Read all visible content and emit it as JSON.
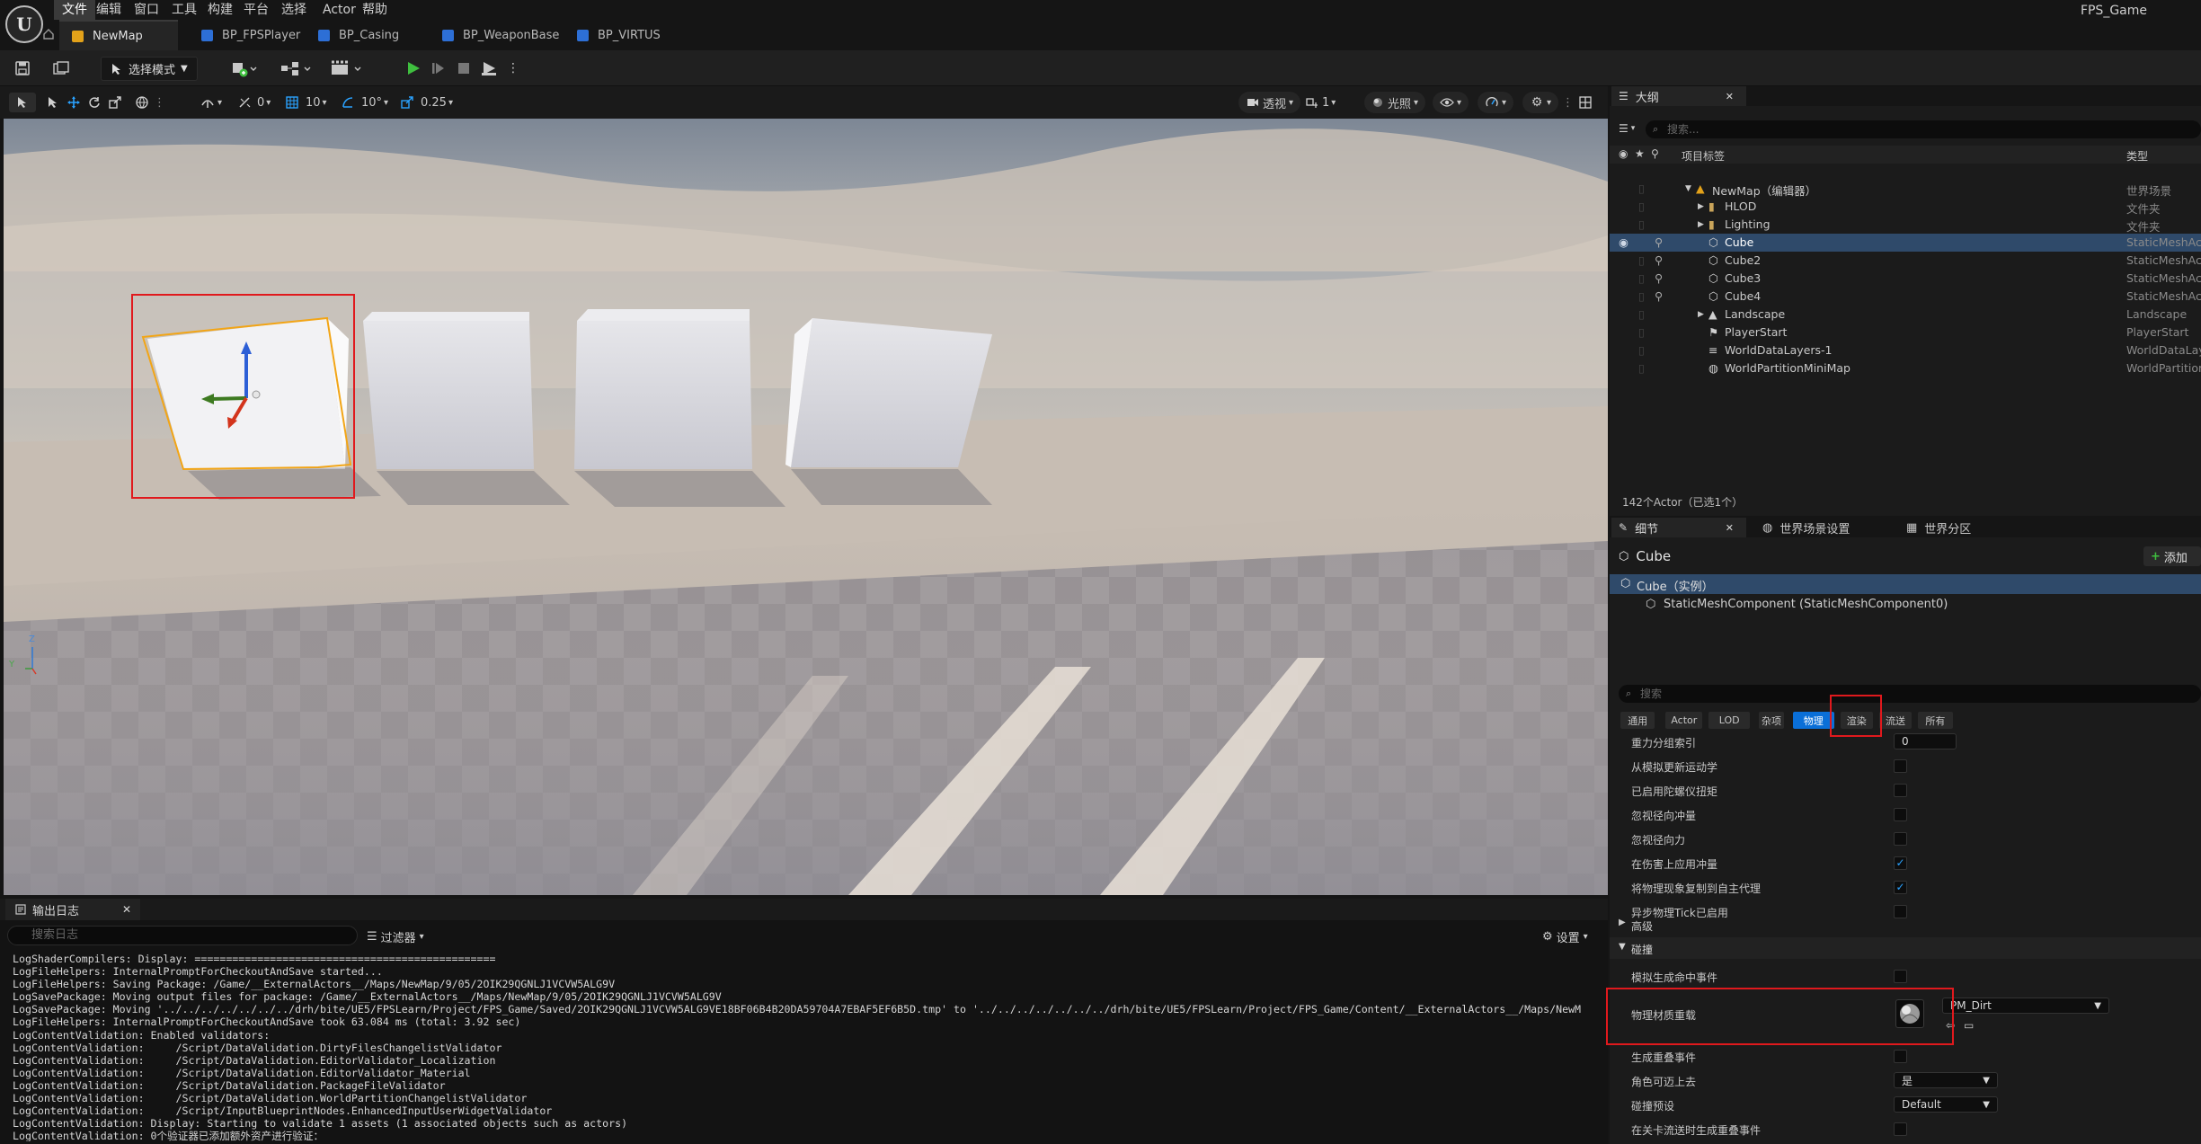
{
  "menu": {
    "items": [
      "文件",
      "编辑",
      "窗口",
      "工具",
      "构建",
      "平台",
      "选择",
      "Actor",
      "帮助"
    ],
    "active_index": 0,
    "project_name": "FPS_Game"
  },
  "tabs": [
    {
      "label": "NewMap",
      "icon": "map-icon",
      "active": true
    },
    {
      "label": "BP_FPSPlayer",
      "icon": "blueprint-icon",
      "active": false
    },
    {
      "label": "BP_Casing",
      "icon": "blueprint-icon",
      "active": false
    },
    {
      "label": "BP_WeaponBase",
      "icon": "blueprint-icon",
      "active": false
    },
    {
      "label": "BP_VIRTUS",
      "icon": "blueprint-icon",
      "active": false
    }
  ],
  "toolbar": {
    "mode_label": "选择模式"
  },
  "viewport_toolbar": {
    "angle_snap_1": "0",
    "grid_snap": "10",
    "rotation_snap": "10°",
    "scale_snap": "0.25",
    "perspective_label": "透视",
    "camera_speed": "1",
    "lighting_label": "光照"
  },
  "viewport": {
    "axis_z": "Z",
    "axis_y": "Y"
  },
  "output_log": {
    "tab_label": "输出日志",
    "search_placeholder": "搜索日志",
    "filter_label": "过滤器",
    "settings_label": "设置",
    "lines": [
      "LogShaderCompilers: Display: ================================================",
      "LogFileHelpers: InternalPromptForCheckoutAndSave started...",
      "LogFileHelpers: Saving Package: /Game/__ExternalActors__/Maps/NewMap/9/05/2OIK29QGNLJ1VCVW5ALG9V",
      "LogSavePackage: Moving output files for package: /Game/__ExternalActors__/Maps/NewMap/9/05/2OIK29QGNLJ1VCVW5ALG9V",
      "LogSavePackage: Moving '../../../../../../../drh/bite/UE5/FPSLearn/Project/FPS_Game/Saved/2OIK29QGNLJ1VCVW5ALG9VE18BF06B4B20DA59704A7EBAF5EF6B5D.tmp' to '../../../../../../../drh/bite/UE5/FPSLearn/Project/FPS_Game/Content/__ExternalActors__/Maps/NewM",
      "LogFileHelpers: InternalPromptForCheckoutAndSave took 63.084 ms (total: 3.92 sec)",
      "LogContentValidation: Enabled validators:",
      "LogContentValidation:     /Script/DataValidation.DirtyFilesChangelistValidator",
      "LogContentValidation:     /Script/DataValidation.EditorValidator_Localization",
      "LogContentValidation:     /Script/DataValidation.EditorValidator_Material",
      "LogContentValidation:     /Script/DataValidation.PackageFileValidator",
      "LogContentValidation:     /Script/DataValidation.WorldPartitionChangelistValidator",
      "LogContentValidation:     /Script/InputBlueprintNodes.EnhancedInputUserWidgetValidator",
      "LogContentValidation: Display: Starting to validate 1 assets (1 associated objects such as actors)",
      "LogContentValidation: 0个验证器已添加额外资产进行验证："
    ]
  },
  "outliner": {
    "tab_label": "大纲",
    "search_placeholder": "搜索...",
    "col_label": "项目标签",
    "col_type": "类型",
    "rows": [
      {
        "label": "NewMap（编辑器）",
        "type": "世界场景",
        "indent": 0,
        "icon": "map-icon",
        "expand": "down",
        "selected": false,
        "eye": false,
        "pin": false
      },
      {
        "label": "HLOD",
        "type": "文件夹",
        "indent": 1,
        "icon": "folder-icon",
        "expand": "right",
        "selected": false,
        "eye": false,
        "pin": false
      },
      {
        "label": "Lighting",
        "type": "文件夹",
        "indent": 1,
        "icon": "folder-icon",
        "expand": "right",
        "selected": false,
        "eye": false,
        "pin": false
      },
      {
        "label": "Cube",
        "type": "StaticMeshActor",
        "indent": 1,
        "icon": "mesh-icon",
        "expand": "",
        "selected": true,
        "eye": true,
        "pin": true
      },
      {
        "label": "Cube2",
        "type": "StaticMeshActor",
        "indent": 1,
        "icon": "mesh-icon",
        "expand": "",
        "selected": false,
        "eye": false,
        "pin": true
      },
      {
        "label": "Cube3",
        "type": "StaticMeshActor",
        "indent": 1,
        "icon": "mesh-icon",
        "expand": "",
        "selected": false,
        "eye": false,
        "pin": true
      },
      {
        "label": "Cube4",
        "type": "StaticMeshActor",
        "indent": 1,
        "icon": "mesh-icon",
        "expand": "",
        "selected": false,
        "eye": false,
        "pin": true
      },
      {
        "label": "Landscape",
        "type": "Landscape",
        "indent": 1,
        "icon": "landscape-icon",
        "expand": "right",
        "selected": false,
        "eye": false,
        "pin": false
      },
      {
        "label": "PlayerStart",
        "type": "PlayerStart",
        "indent": 1,
        "icon": "player-start-icon",
        "expand": "",
        "selected": false,
        "eye": false,
        "pin": false
      },
      {
        "label": "WorldDataLayers-1",
        "type": "WorldDataLayers",
        "indent": 1,
        "icon": "data-layers-icon",
        "expand": "",
        "selected": false,
        "eye": false,
        "pin": false
      },
      {
        "label": "WorldPartitionMiniMap",
        "type": "WorldPartitionMiniMap",
        "indent": 1,
        "icon": "minimap-icon",
        "expand": "",
        "selected": false,
        "eye": false,
        "pin": false
      }
    ],
    "actor_count": "142个Actor（已选1个）"
  },
  "details": {
    "tabs": [
      "细节",
      "世界场景设置",
      "世界分区"
    ],
    "actor_name": "Cube",
    "add_label": "添加",
    "instance_label": "Cube（实例）",
    "component_label": "StaticMeshComponent (StaticMeshComponent0)",
    "search_placeholder": "搜索",
    "category_tabs": [
      "通用",
      "Actor",
      "LOD",
      "杂项",
      "物理",
      "渲染",
      "流送",
      "所有"
    ],
    "active_category": 4,
    "physics_props": [
      {
        "label": "重力分组索引",
        "kind": "number",
        "value": "0"
      },
      {
        "label": "从模拟更新运动学",
        "kind": "check",
        "checked": false
      },
      {
        "label": "已启用陀螺仪扭矩",
        "kind": "check",
        "checked": false
      },
      {
        "label": "忽视径向冲量",
        "kind": "check",
        "checked": false
      },
      {
        "label": "忽视径向力",
        "kind": "check",
        "checked": false
      },
      {
        "label": "在伤害上应用冲量",
        "kind": "check",
        "checked": true
      },
      {
        "label": "将物理现象复制到自主代理",
        "kind": "check",
        "checked": true
      },
      {
        "label": "异步物理Tick已启用",
        "kind": "check",
        "checked": false
      }
    ],
    "advanced_label": "高级",
    "collision_label": "碰撞",
    "collision_props_top": [
      {
        "label": "模拟生成命中事件",
        "kind": "check",
        "checked": false
      }
    ],
    "phys_material_label": "物理材质重载",
    "phys_material_value": "PM_Dirt",
    "collision_props_bottom": [
      {
        "label": "生成重叠事件",
        "kind": "check",
        "checked": false
      },
      {
        "label": "角色可迈上去",
        "kind": "dropdown",
        "value": "是"
      },
      {
        "label": "碰撞预设",
        "kind": "dropdown",
        "value": "Default"
      },
      {
        "label": "在关卡流送时生成重叠事件",
        "kind": "check",
        "checked": false
      }
    ]
  },
  "colors": {
    "accent_blue": "#0a6fd8",
    "selection_red": "#e0191d",
    "selected_actor_outline": "#f2a516",
    "play_green": "#3fbf3f"
  }
}
